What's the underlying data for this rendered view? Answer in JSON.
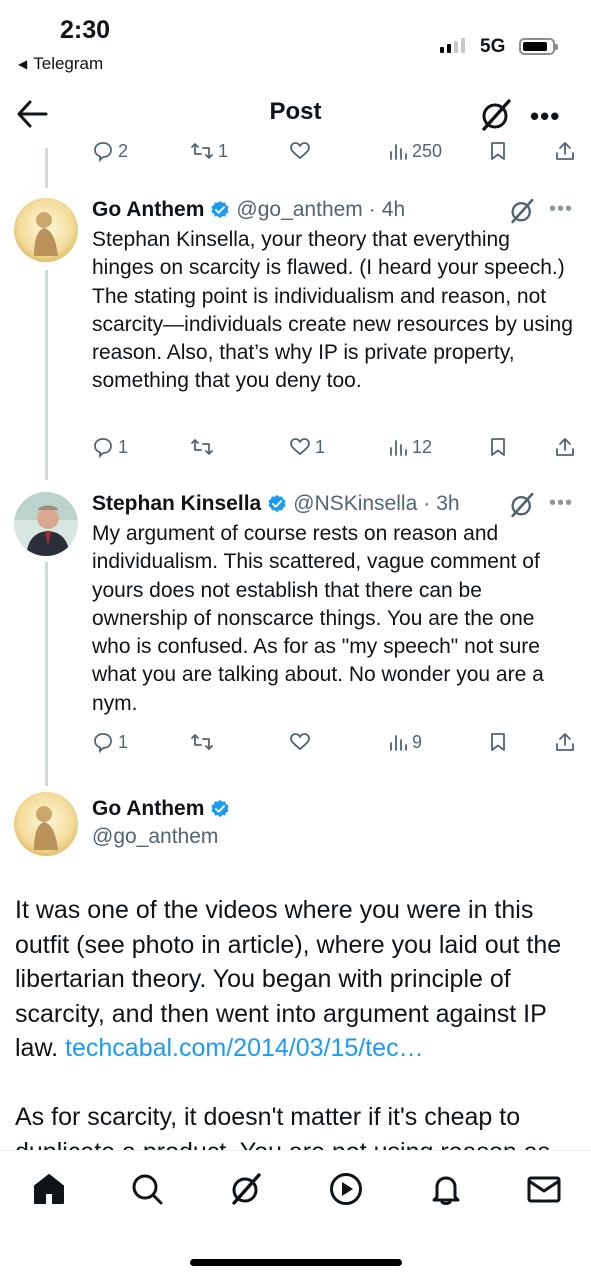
{
  "status_bar": {
    "time": "2:30",
    "back_app": "Telegram",
    "network": "5G"
  },
  "header": {
    "title": "Post"
  },
  "parent_actions": {
    "replies": "2",
    "reposts": "1",
    "views": "250"
  },
  "tweets": [
    {
      "name": "Go Anthem",
      "handle": "@go_anthem",
      "time": "4h",
      "text": "Stephan Kinsella, your theory that everything hinges on scarcity is flawed.  (I heard your speech.) The stating point is individualism and reason, not scarcity—individuals create new resources by using reason. Also, that’s why IP is private property, something that you deny too.",
      "replies": "1",
      "reposts": "",
      "likes": "1",
      "views": "12"
    },
    {
      "name": "Stephan Kinsella",
      "handle": "@NSKinsella",
      "time": "3h",
      "text": "My argument of course rests on reason and individualism. This scattered, vague comment of yours does not establish that there can be ownership of nonscarce things. You are the one who is confused. As for as \"my speech\" not sure what you are talking about. No wonder you are a nym.",
      "replies": "1",
      "reposts": "",
      "likes": "",
      "views": "9"
    }
  ],
  "main_post": {
    "name": "Go Anthem",
    "handle": "@go_anthem",
    "text_part1": "It was one of the videos where you were in this outfit (see photo in article), where you laid out the libertarian theory. You began with principle of scarcity, and then went into argument against IP law. ",
    "link": "techcabal.com/2014/03/15/tec…",
    "text_part2": "As for scarcity, it doesn't matter if it's cheap to duplicate a product. You are not using reason as"
  },
  "colors": {
    "accent": "#1d9bf0",
    "muted": "#536471",
    "line": "#cfd9de"
  },
  "bottom_nav": [
    "home-icon",
    "search-icon",
    "grok-icon",
    "play-icon",
    "bell-icon",
    "mail-icon"
  ]
}
